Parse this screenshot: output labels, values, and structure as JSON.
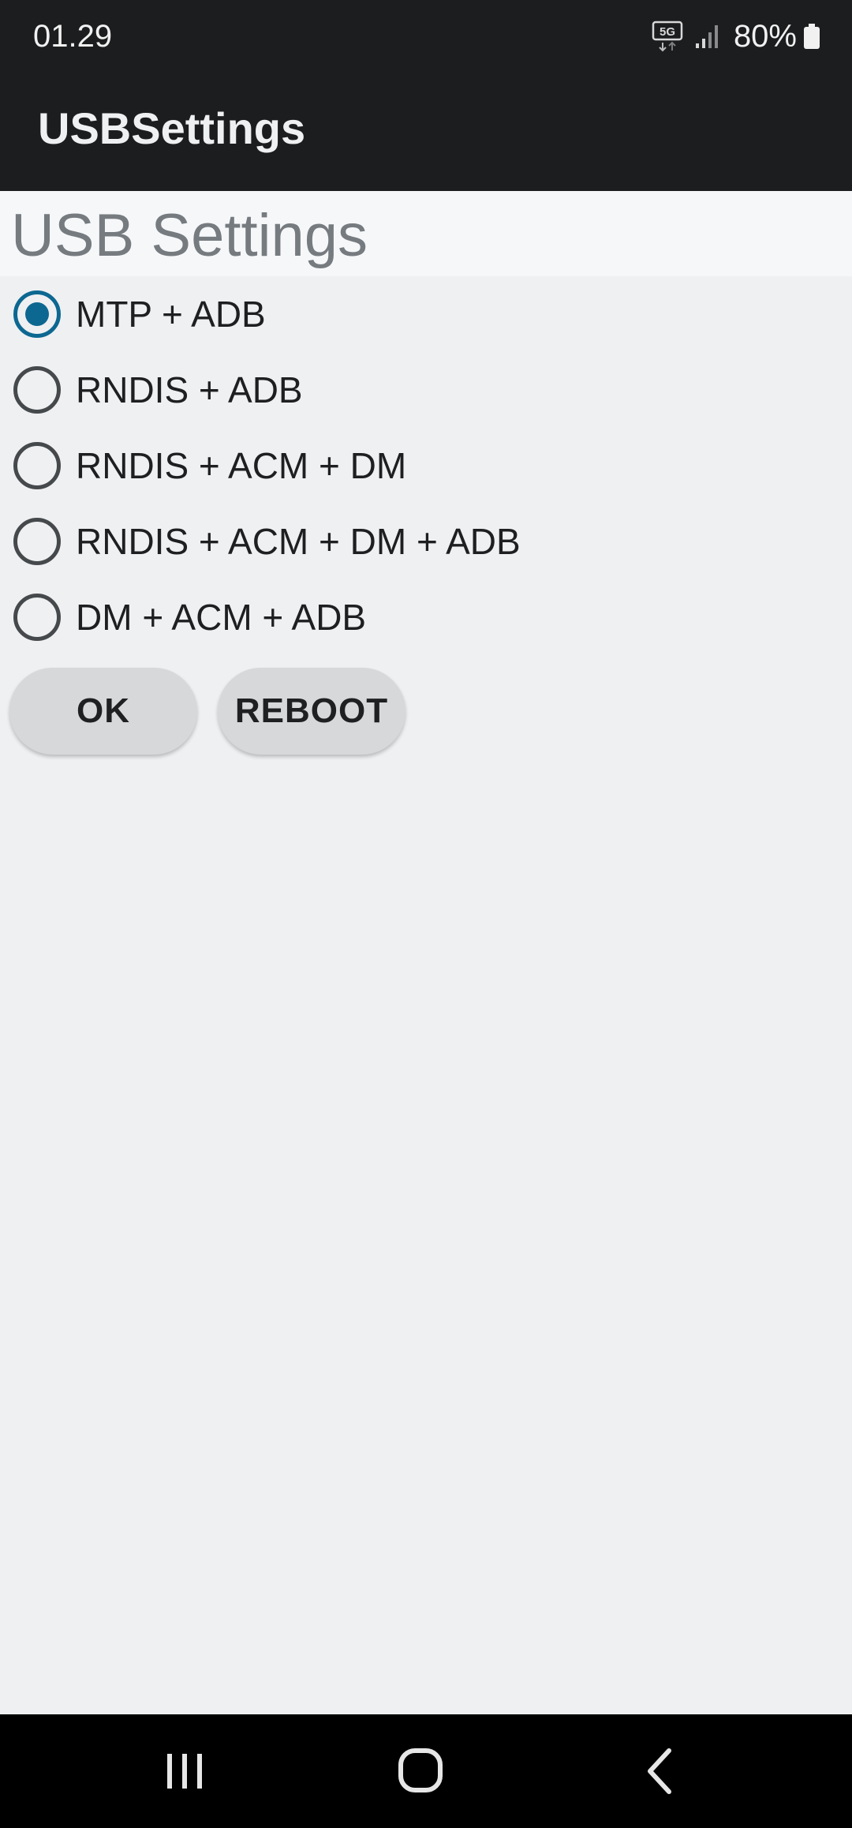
{
  "status_bar": {
    "time": "01.29",
    "network_icon": "5g-icon",
    "signal_icon": "signal-icon",
    "battery_percent": "80%",
    "battery_icon": "battery-icon"
  },
  "app_bar": {
    "title": "USBSettings"
  },
  "page": {
    "heading": "USB Settings"
  },
  "usb_modes": {
    "selected": "MTP + ADB",
    "options": [
      {
        "label": "MTP + ADB",
        "checked": true
      },
      {
        "label": "RNDIS + ADB",
        "checked": false
      },
      {
        "label": "RNDIS + ACM + DM",
        "checked": false
      },
      {
        "label": "RNDIS + ACM + DM + ADB",
        "checked": false
      },
      {
        "label": "DM + ACM + ADB",
        "checked": false
      }
    ]
  },
  "buttons": {
    "ok_label": "OK",
    "reboot_label": "REBOOT"
  },
  "nav_bar": {
    "recents_icon": "recents-icon",
    "home_icon": "home-icon",
    "back_icon": "back-icon"
  },
  "colors": {
    "accent": "#0c6891",
    "bar_background": "#1c1d1f",
    "page_background": "#eff0f2"
  }
}
